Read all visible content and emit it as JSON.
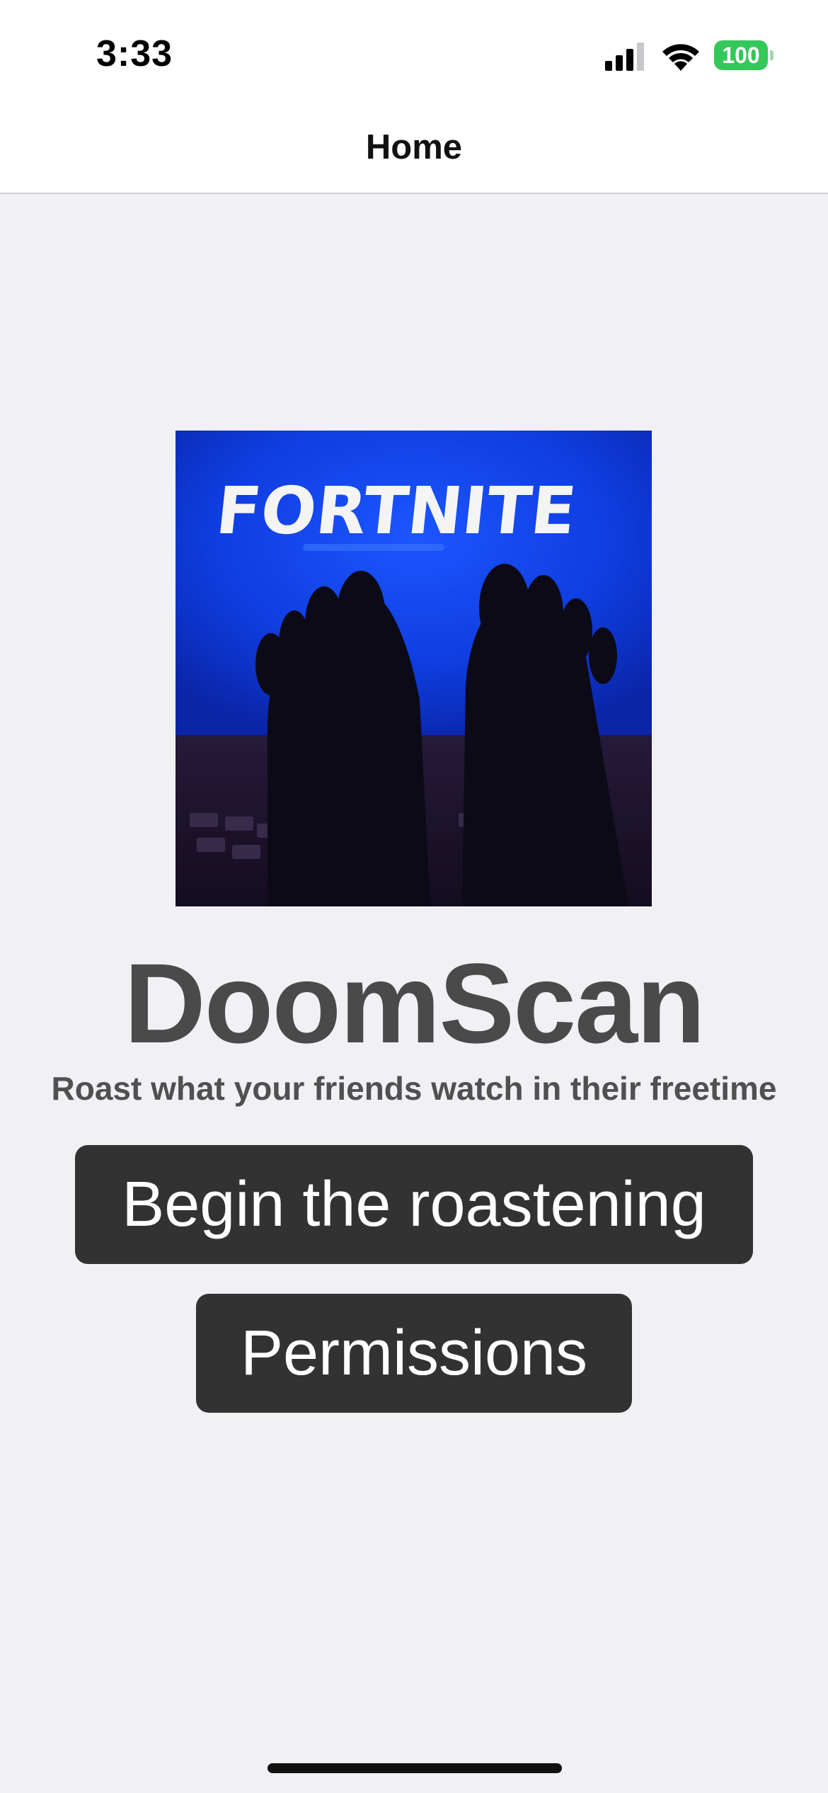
{
  "status_bar": {
    "time": "3:33",
    "battery_level": "100",
    "battery_color": "#34c759"
  },
  "nav": {
    "title": "Home"
  },
  "hero": {
    "image_text": "FORTNITE",
    "icon": "hero-photo"
  },
  "app": {
    "title": "DoomScan",
    "tagline": "Roast what your friends watch in their freetime"
  },
  "buttons": {
    "begin_label": "Begin the roastening",
    "permissions_label": "Permissions",
    "button_color": "#323232"
  }
}
